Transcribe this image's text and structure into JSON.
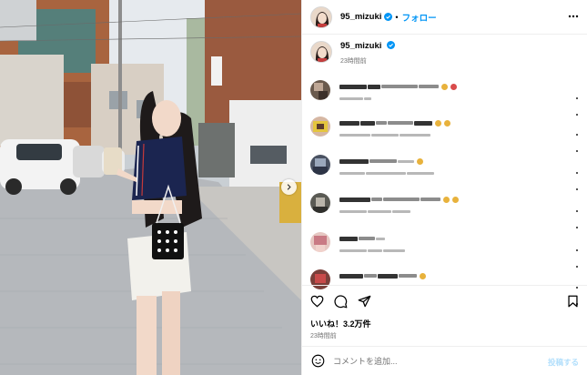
{
  "post": {
    "username": "95_mizuki",
    "follow_label": "フォロー",
    "separator": "•",
    "caption_glyph": "",
    "caption_time": "23時間前",
    "likes": "いいね！3.2万件",
    "post_time": "23時間前"
  },
  "comment_box": {
    "placeholder": "コメントを追加...",
    "post_label": "投稿する"
  },
  "colors": {
    "accent": "#0095f6",
    "post_disabled": "#b2dffc",
    "verified": "#0095f6",
    "muted": "#737373"
  },
  "icons": [
    "more-horizontal-icon",
    "verified-badge-icon",
    "heart-icon",
    "comment-icon",
    "share-icon",
    "bookmark-icon",
    "emoji-icon",
    "chevron-right-icon"
  ]
}
